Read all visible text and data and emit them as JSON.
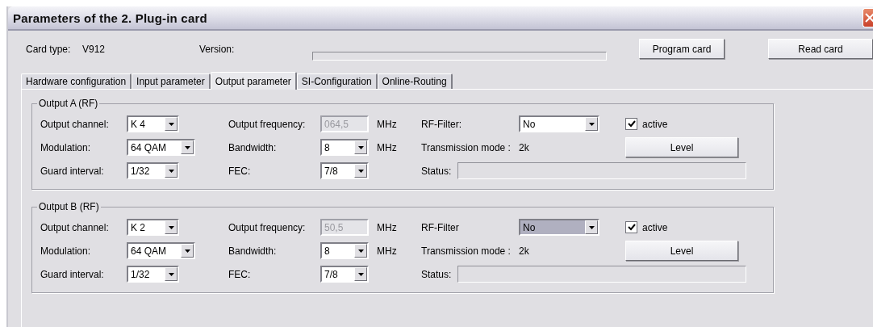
{
  "window": {
    "title": "Parameters of the 2. Plug-in card"
  },
  "card": {
    "type_label": "Card type:",
    "type_value": "V912",
    "version_label": "Version:",
    "version_progress": {
      "level": 0
    }
  },
  "buttons": [
    "Program card",
    "Read card"
  ],
  "tabs": [
    {
      "label": "Hardware configuration",
      "selected": false
    },
    {
      "label": "Input parameter",
      "selected": false
    },
    {
      "label": "Output parameter",
      "selected": true
    },
    {
      "label": "SI-Configuration",
      "selected": false
    },
    {
      "label": "Online-Routing",
      "selected": false
    }
  ],
  "outputs": [
    {
      "title": "Output A (RF)",
      "channel": {
        "label": "Output channel:",
        "value": "K 4"
      },
      "frequency": {
        "label": "Output frequency:",
        "value": "064,5",
        "unit": "MHz",
        "disabled": true
      },
      "rf_filter": {
        "label": "RF-Filter:",
        "value": "No",
        "highlighted": false
      },
      "active": {
        "label": "active",
        "checked": true
      },
      "modulation": {
        "label": "Modulation:",
        "value": "64 QAM"
      },
      "bandwidth": {
        "label": "Bandwidth:",
        "value": "8",
        "unit": "MHz"
      },
      "transmission_mode": {
        "label": "Transmission mode :",
        "value": "2k"
      },
      "level_button": "Level",
      "guard": {
        "label": "Guard interval:",
        "value": "1/32"
      },
      "fec": {
        "label": "FEC:",
        "value": "7/8"
      },
      "status": {
        "label": "Status:"
      }
    },
    {
      "title": "Output B (RF)",
      "channel": {
        "label": "Output channel:",
        "value": "K 2"
      },
      "frequency": {
        "label": "Output frequency:",
        "value": "50,5",
        "unit": "MHz",
        "disabled": true
      },
      "rf_filter": {
        "label": "RF-Filter",
        "value": "No",
        "highlighted": true
      },
      "active": {
        "label": "active",
        "checked": true
      },
      "modulation": {
        "label": "Modulation:",
        "value": "64 QAM"
      },
      "bandwidth": {
        "label": "Bandwidth:",
        "value": "8",
        "unit": "MHz"
      },
      "transmission_mode": {
        "label": "Transmission mode :",
        "value": "2k"
      },
      "level_button": "Level",
      "guard": {
        "label": "Guard interval:",
        "value": "1/32"
      },
      "fec": {
        "label": "FEC:",
        "value": "7/8"
      },
      "status": {
        "label": "Status:"
      }
    }
  ]
}
